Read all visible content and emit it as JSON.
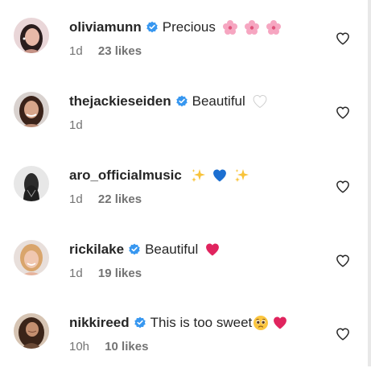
{
  "comments": [
    {
      "username": "oliviamunn",
      "verified": true,
      "text": "Precious",
      "time": "1d",
      "likes": "23 likes"
    },
    {
      "username": "thejackieseiden",
      "verified": true,
      "text": "Beautiful",
      "time": "1d",
      "likes": ""
    },
    {
      "username": "aro_officialmusic",
      "verified": false,
      "text": "",
      "time": "1d",
      "likes": "22 likes"
    },
    {
      "username": "rickilake",
      "verified": true,
      "text": "Beautiful",
      "time": "1d",
      "likes": "19 likes"
    },
    {
      "username": "nikkireed",
      "verified": true,
      "text": "This is too sweet",
      "time": "10h",
      "likes": "10 likes"
    }
  ],
  "icons": {
    "verified": "verified-badge-icon",
    "like": "heart-outline-icon",
    "emoji_flowers": "cherry-blossom-icon",
    "emoji_white_heart": "white-heart-icon",
    "emoji_sparkles": "sparkles-icon",
    "emoji_blue_heart": "blue-heart-icon",
    "emoji_red_heart": "red-heart-icon",
    "emoji_pleading": "pleading-face-icon"
  },
  "colors": {
    "verified_blue": "#3797f0",
    "meta_gray": "#737373",
    "text_dark": "#262626"
  }
}
